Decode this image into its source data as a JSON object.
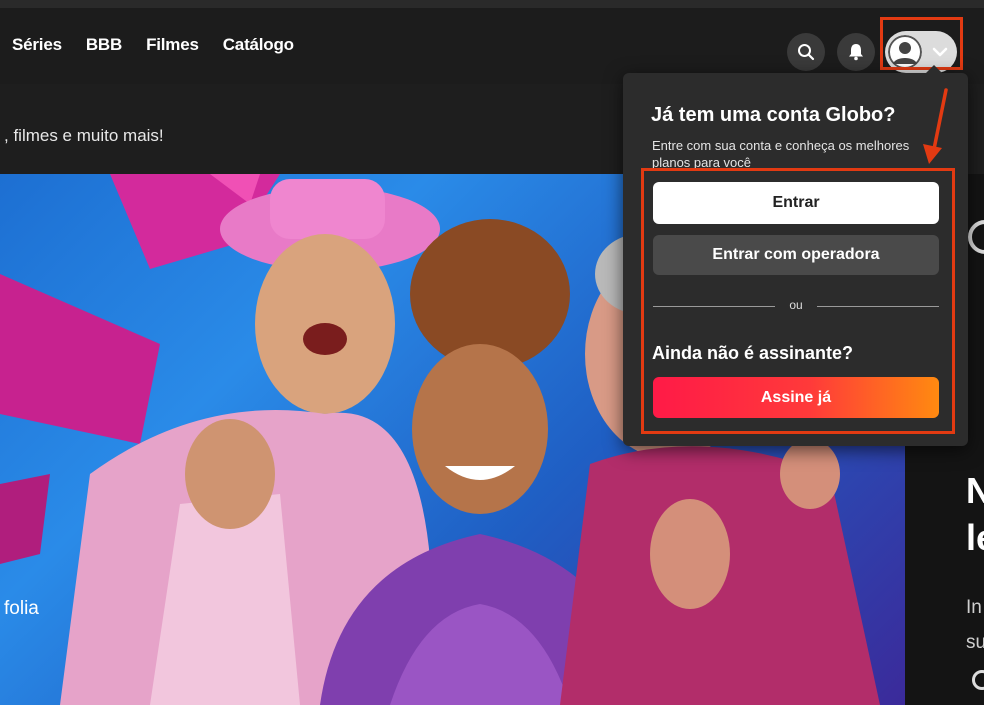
{
  "nav": {
    "items": [
      "Séries",
      "BBB",
      "Filmes",
      "Catálogo"
    ]
  },
  "header": {
    "subtitle": ", filmes e muito mais!"
  },
  "hero": {
    "caption": "folia"
  },
  "right_panel": {
    "big_1": "N",
    "big_2": "le",
    "small_1": "In",
    "small_2": "su"
  },
  "login_menu": {
    "title": "Já tem uma conta Globo?",
    "description": "Entre com sua conta e conheça os melhores planos para você",
    "signin_button": "Entrar",
    "operator_button": "Entrar com operadora",
    "divider_text": "ou",
    "subscribe_heading": "Ainda não é assinante?",
    "subscribe_button": "Assine já"
  },
  "colors": {
    "highlight": "#e23a12",
    "subscribe_start": "#ff1a47",
    "subscribe_end": "#ff8a10"
  },
  "icons": [
    "search-icon",
    "bell-icon",
    "user-avatar-icon",
    "chevron-down-icon",
    "annotation-arrow-icon"
  ]
}
